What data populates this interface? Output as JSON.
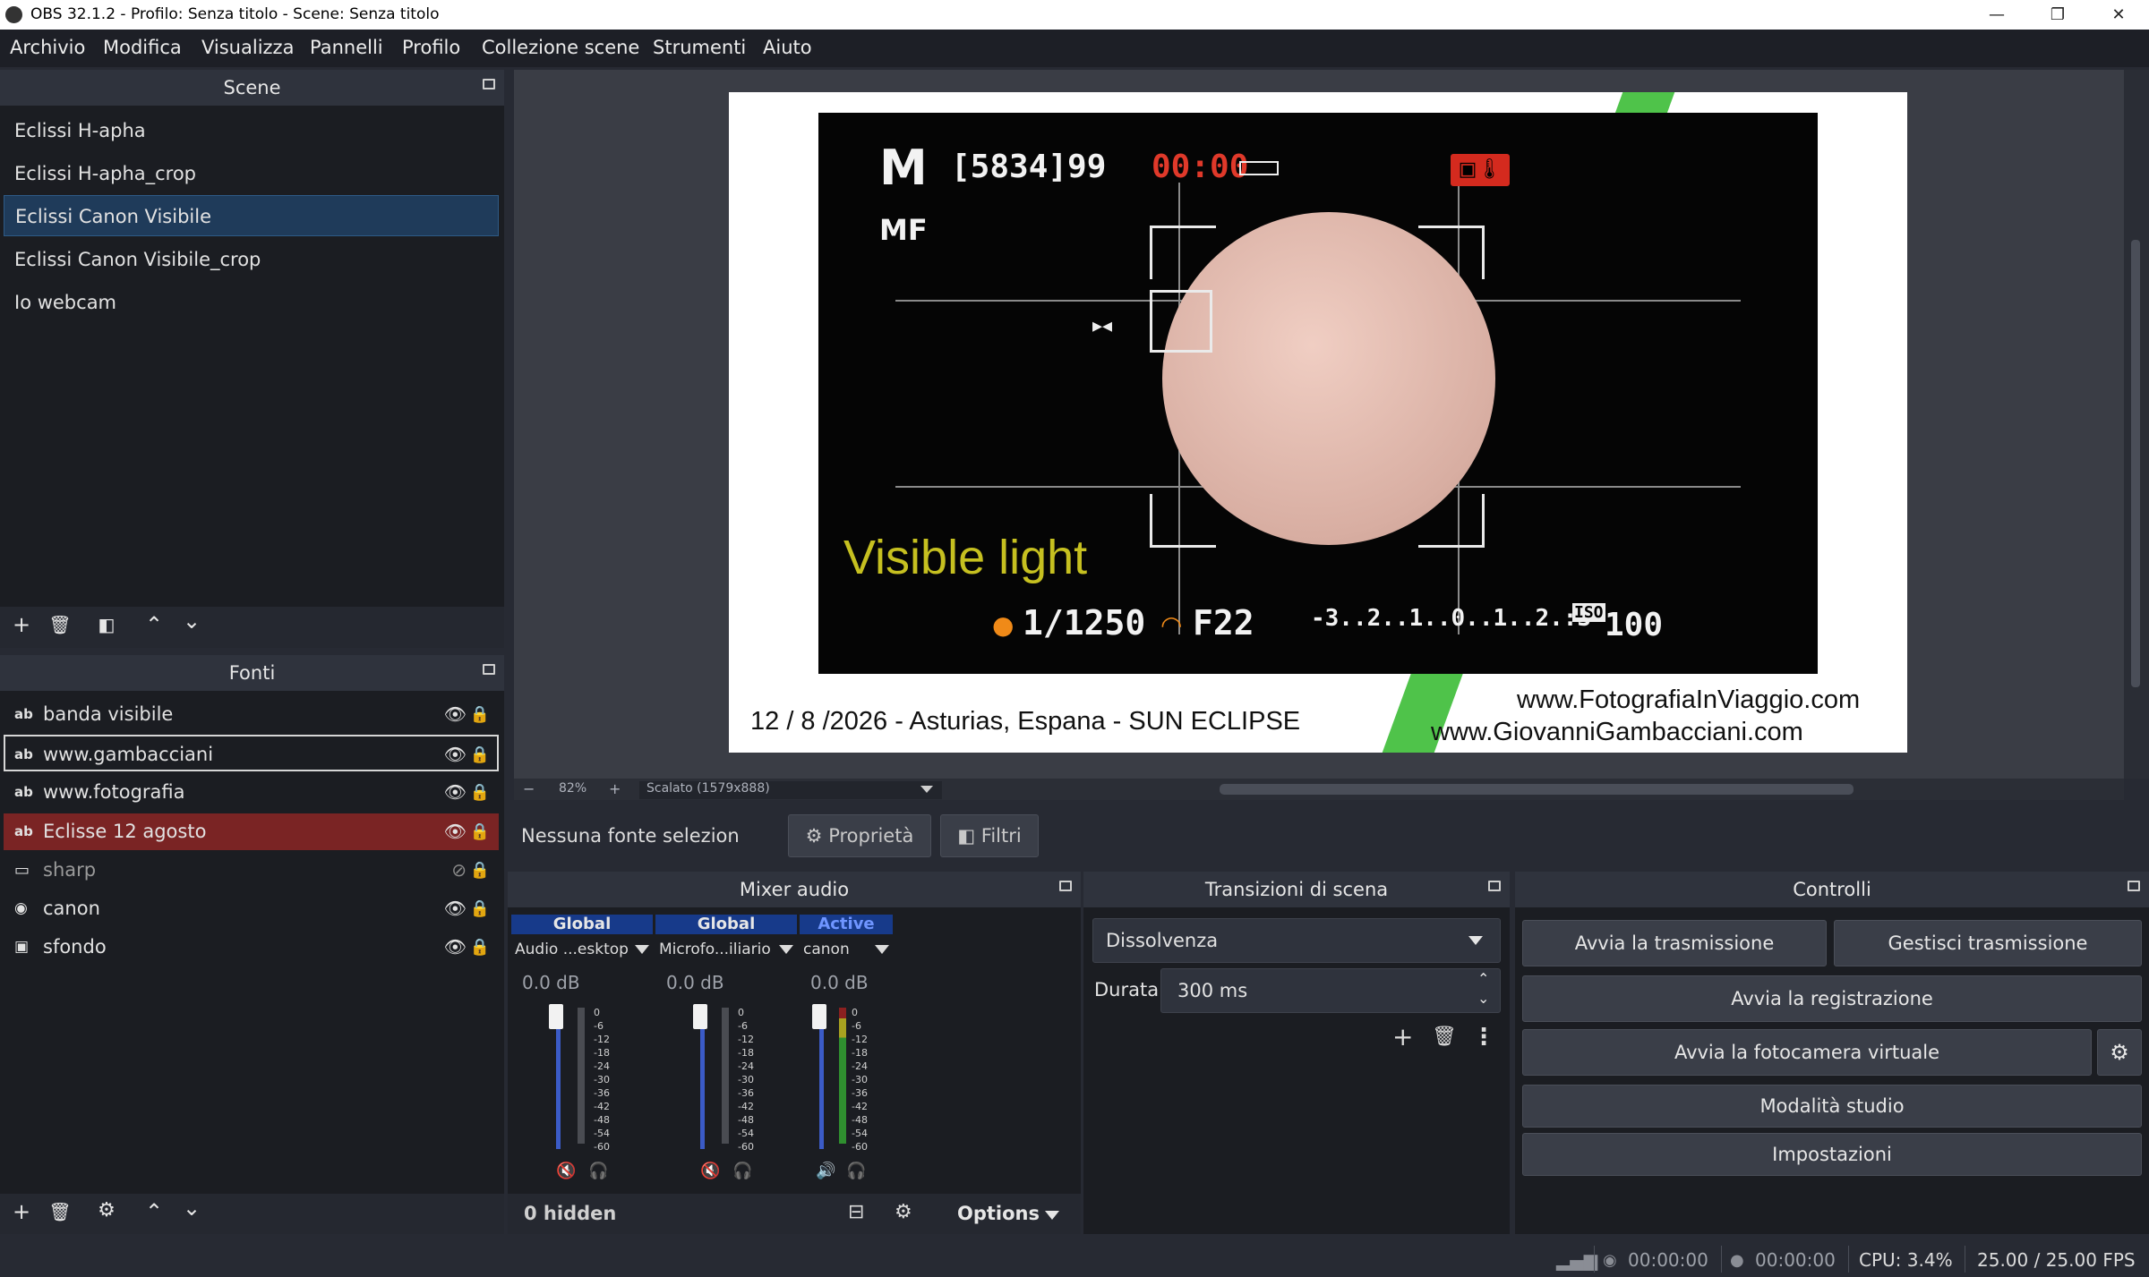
{
  "window": {
    "title": "OBS 32.1.2 - Profilo: Senza titolo - Scene: Senza titolo",
    "minimize": "—",
    "maximize": "❐",
    "close": "✕"
  },
  "menu": [
    "Archivio",
    "Modifica",
    "Visualizza",
    "Pannelli",
    "Profilo",
    "Collezione scene",
    "Strumenti",
    "Aiuto"
  ],
  "scenes": {
    "title": "Scene",
    "items": [
      "Eclissi H-apha",
      "Eclissi H-apha_crop",
      "Eclissi Canon Visibile",
      "Eclissi Canon Visibile_crop",
      "Io webcam"
    ],
    "selected_index": 2
  },
  "sources": {
    "title": "Fonti",
    "items": [
      {
        "icon": "ab",
        "name": "banda visibile",
        "visible": true
      },
      {
        "icon": "ab",
        "name": "www.gambacciani",
        "visible": true
      },
      {
        "icon": "ab",
        "name": "www.fotografia",
        "visible": true
      },
      {
        "icon": "ab",
        "name": "Eclisse 12 agosto",
        "visible": true
      },
      {
        "icon": "window",
        "name": "sharp",
        "visible": false
      },
      {
        "icon": "camera",
        "name": "canon",
        "visible": true
      },
      {
        "icon": "image",
        "name": "sfondo",
        "visible": true
      }
    ]
  },
  "preview": {
    "cam_mode": "M",
    "cam_shots": "[5834]99",
    "cam_time": "00:00",
    "cam_focus": "MF",
    "overlay_text": "Visible light",
    "shutter": "1/1250",
    "aperture": "F22",
    "exposure_scale": "-3..2..1..0..1..2.:3",
    "iso_label": "ISO",
    "iso_value": "100",
    "caption": "12 / 8 /2026 - Asturias, Espana - SUN ECLIPSE",
    "url1": "www.FotografiaInViaggio.com",
    "url2": "www.GiovanniGambacciani.com",
    "zoom_minus": "−",
    "zoom": "82%",
    "zoom_plus": "+",
    "scale_label": "Scalato (1579x888)"
  },
  "context": {
    "no_source": "Nessuna fonte selezion",
    "properties": "Proprietà",
    "filters": "Filtri"
  },
  "mixer": {
    "title": "Mixer audio",
    "channels": [
      {
        "header": "Global",
        "name": "Audio ...esktop",
        "db": "0.0 dB",
        "muted": true
      },
      {
        "header": "Global",
        "name": "Microfo...iliario",
        "db": "0.0 dB",
        "muted": true
      },
      {
        "header": "Active",
        "name": "canon",
        "db": "0.0 dB",
        "muted": false
      }
    ],
    "scale": [
      "0",
      "-6",
      "-12",
      "-18",
      "-24",
      "-30",
      "-36",
      "-42",
      "-48",
      "-54",
      "-60"
    ],
    "hidden": "0 hidden",
    "options": "Options"
  },
  "transitions": {
    "title": "Transizioni di scena",
    "selected": "Dissolvenza",
    "duration_label": "Durata",
    "duration": "300 ms"
  },
  "controls": {
    "title": "Controlli",
    "start_stream": "Avvia la trasmissione",
    "manage_stream": "Gestisci trasmissione",
    "start_record": "Avvia la registrazione",
    "virtual_cam": "Avvia la fotocamera virtuale",
    "studio_mode": "Modalità studio",
    "settings": "Impostazioni"
  },
  "status": {
    "stream_time": "00:00:00",
    "record_time": "00:00:00",
    "cpu": "CPU: 3.4%",
    "fps": "25.00 / 25.00 FPS"
  }
}
